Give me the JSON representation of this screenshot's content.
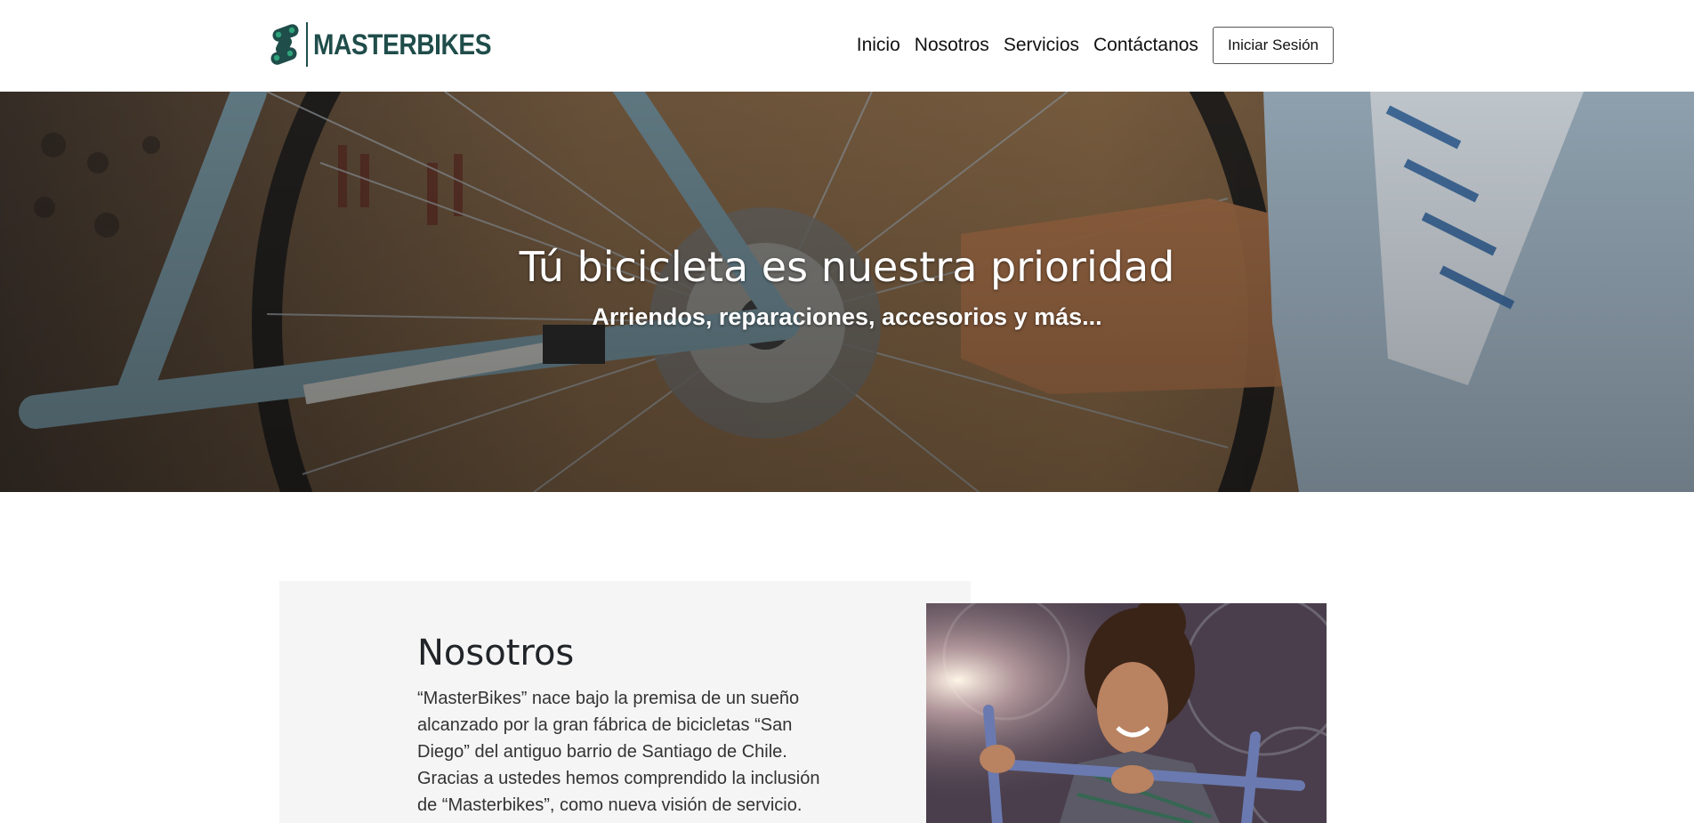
{
  "nav": {
    "brand": "MASTERBIKES",
    "links": [
      "Inicio",
      "Nosotros",
      "Servicios",
      "Contáctanos"
    ],
    "login_label": "Iniciar Sesión"
  },
  "hero": {
    "title": "Tú bicicleta es nuestra prioridad",
    "subtitle": "Arriendos, reparaciones, accesorios y más..."
  },
  "about": {
    "title": "Nosotros",
    "text": "“MasterBikes” nace bajo la premisa de un sueño alcanzado por la gran fábrica de bicicletas “San Diego” del antiguo barrio de Santiago de Chile. Gracias a ustedes hemos comprendido la inclusión de “Masterbikes”, como nueva visión de servicio."
  },
  "colors": {
    "brand": "#1f4d4a",
    "panel_bg": "#f5f5f5"
  },
  "icons": {
    "logo": "bike-chain-logo-icon"
  }
}
